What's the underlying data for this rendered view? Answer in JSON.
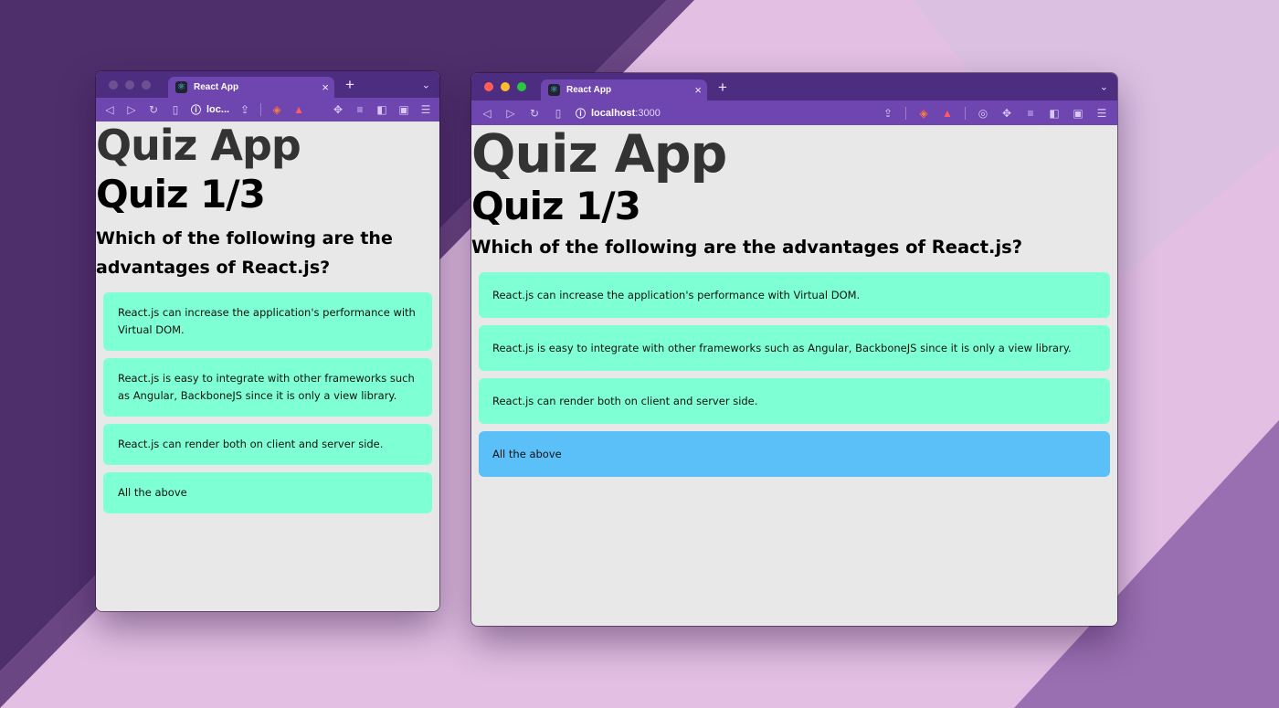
{
  "colors": {
    "tabbar": "#4d2d80",
    "toolbar": "#6f45b0",
    "content_bg": "#e8e8e8",
    "option_default": "#7fffd4",
    "option_selected": "#5bc0f8",
    "traffic_red": "#ff5f57",
    "traffic_yellow": "#febc2e",
    "traffic_green": "#28c840"
  },
  "window_small": {
    "tab_title": "React App",
    "url_text": "loc...",
    "app_title": "Quiz App",
    "quiz_title": "Quiz 1/3",
    "question": "Which of the following are the advantages of React.js?",
    "options": [
      "React.js can increase the application's performance with Virtual DOM.",
      "React.js is easy to integrate with other frameworks such as Angular, BackboneJS since it is only a view library.",
      "React.js can render both on client and server side.",
      "All the above"
    ],
    "selected_option": null
  },
  "window_large": {
    "tab_title": "React App",
    "url_host": "localhost",
    "url_port": ":3000",
    "app_title": "Quiz App",
    "quiz_title": "Quiz 1/3",
    "question": "Which of the following are the advantages of React.js?",
    "options": [
      "React.js can increase the application's performance with Virtual DOM.",
      "React.js is easy to integrate with other frameworks such as Angular, BackboneJS since it is only a view library.",
      "React.js can render both on client and server side.",
      "All the above"
    ],
    "selected_option": 3
  },
  "glyphs": {
    "back": "◁",
    "forward": "▷",
    "reload": "↻",
    "bookmark": "▯",
    "info": "ⓘ",
    "share": "⇪",
    "brave": "◈",
    "warn": "▲",
    "chrome": "◎",
    "extensions": "✥",
    "playlist": "≡",
    "sidebar": "◧",
    "wallet": "▣",
    "menu": "☰",
    "close": "×",
    "new_tab": "+",
    "tab_menu": "⌄",
    "react": "⚛"
  }
}
